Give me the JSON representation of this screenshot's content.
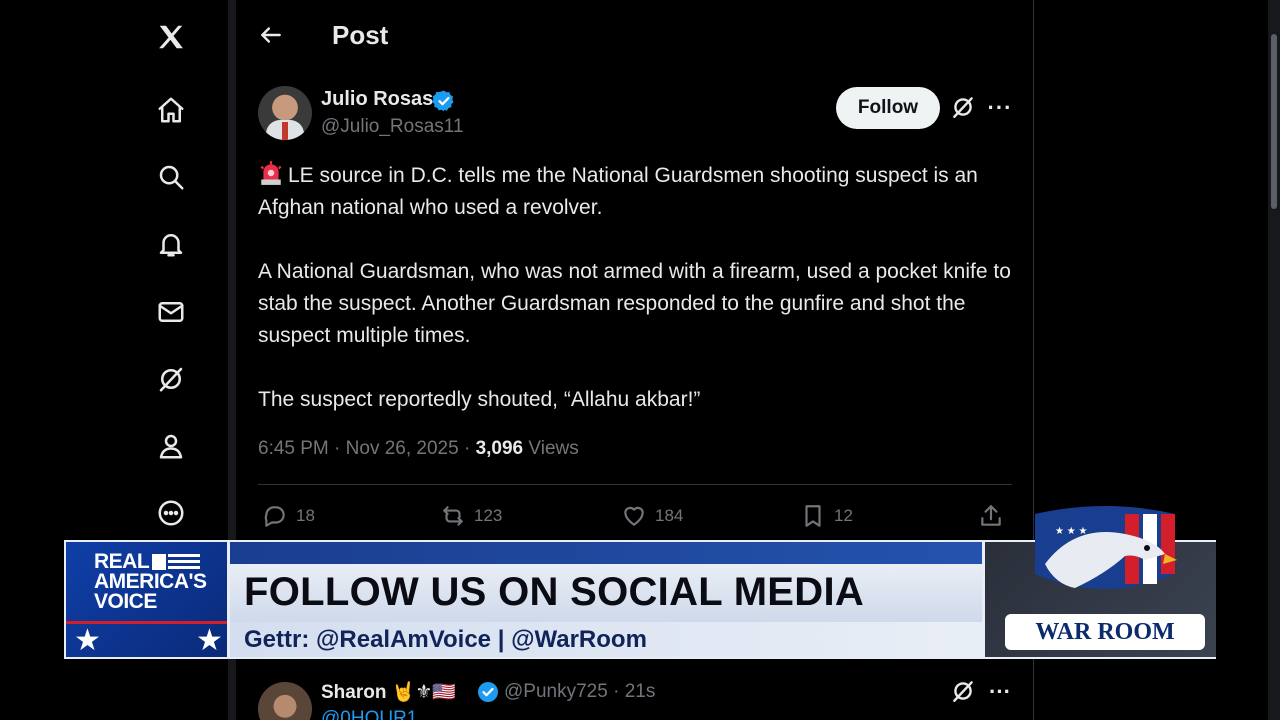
{
  "nav": {
    "items": [
      {
        "name": "x-logo-icon"
      },
      {
        "name": "home-icon"
      },
      {
        "name": "explore-icon"
      },
      {
        "name": "notifications-icon"
      },
      {
        "name": "messages-icon"
      },
      {
        "name": "grok-icon"
      },
      {
        "name": "profile-icon"
      },
      {
        "name": "more-icon"
      }
    ]
  },
  "header": {
    "title": "Post"
  },
  "post": {
    "author_name": "Julio Rosas",
    "author_handle": "@Julio_Rosas11",
    "follow_label": "Follow",
    "paragraphs": [
      "LE source in D.C. tells me the National Guardsmen shooting suspect is an Afghan national who used a revolver.",
      "A National Guardsman, who was not armed with a firearm, used a pocket knife to stab the suspect. Another Guardsman responded to the gunfire and shot the suspect multiple times.",
      "The suspect reportedly shouted, “Allahu akbar!”"
    ],
    "time": "6:45 PM",
    "date": "Nov 26, 2025",
    "views_count": "3,096",
    "views_label": "Views",
    "replies": "18",
    "reposts": "123",
    "likes": "184",
    "bookmarks": "12"
  },
  "reply": {
    "name": "Sharon",
    "emojis": "🤘⚜🇺🇸",
    "handle": "@Punky725",
    "age": "21s",
    "sub": "@0HOUR1"
  },
  "banner": {
    "brand_line1": "REAL",
    "brand_line2": "AMERICA'S",
    "brand_line3": "VOICE",
    "headline": "FOLLOW US ON SOCIAL MEDIA",
    "subline": "Gettr: @RealAmVoice | @WarRoom",
    "show_logo": "WAR ROOM"
  },
  "colors": {
    "background": "#000000",
    "text": "#e7e9ea",
    "muted": "#71767b",
    "verified": "#1d9bf0",
    "banner_blue": "#0d2f7e",
    "banner_light": "#e9eef6"
  }
}
